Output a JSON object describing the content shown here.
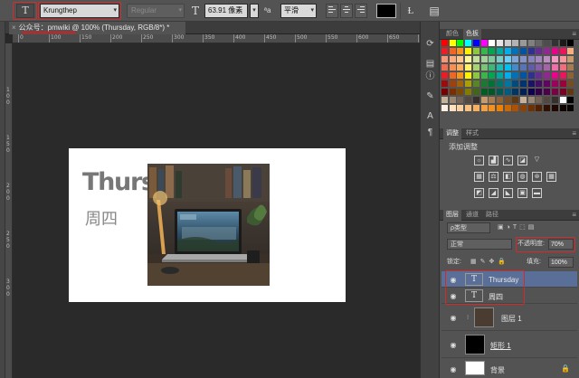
{
  "options_bar": {
    "tool_icon": "T",
    "font_family": "Krungthep",
    "font_style": "Regular",
    "font_size": "63.91 像素",
    "antialias_icon": "ªa",
    "antialias": "平滑",
    "text_color": "#000000"
  },
  "document": {
    "tab_title": "公众号：pmwiki @ 100% (Thursday, RGB/8*) *",
    "tab_close": "×",
    "ruler_h": [
      "0",
      "100",
      "150",
      "200",
      "250",
      "300",
      "350",
      "400",
      "450",
      "500",
      "550",
      "600",
      "650",
      "700"
    ],
    "ruler_v": [
      "1",
      "0",
      "0",
      "1",
      "5",
      "0",
      "2",
      "0",
      "0",
      "2",
      "5",
      "0",
      "3",
      "0",
      "0"
    ]
  },
  "canvas": {
    "heading": "Thursday",
    "subheading": "周四",
    "background": "#ffffff"
  },
  "panels": {
    "swatches_tabs": [
      "颜色",
      "色板"
    ],
    "adjust_tabs": [
      "调整",
      "样式"
    ],
    "adjust_title": "添加调整",
    "layers_tabs": [
      "图层",
      "通道",
      "路径"
    ],
    "filter_kind": "ρ类型",
    "blend_mode": "正常",
    "opacity_label": "不透明度:",
    "opacity_value": "70%",
    "lock_label": "锁定:",
    "fill_label": "填充:",
    "fill_value": "100%",
    "layers": [
      {
        "name": "Thursday",
        "type": "text",
        "selected": true
      },
      {
        "name": "周四",
        "type": "text"
      },
      {
        "name": "图层 1",
        "type": "image"
      },
      {
        "name": "矩形 1",
        "type": "shape"
      },
      {
        "name": "背景",
        "type": "background"
      }
    ]
  },
  "colors": {
    "highlight_red": "#d52a2a",
    "panel_bg": "#535353",
    "workspace_bg": "#2a2a2a",
    "selected_layer": "#5a6f98"
  },
  "icons": [
    "text-tool-icon",
    "font-size-icon",
    "antialias-icon",
    "align-left-icon",
    "align-center-icon",
    "align-right-icon",
    "warp-text-icon",
    "character-panel-icon",
    "eye-icon",
    "lock-icon",
    "link-icon",
    "fx-icon",
    "mask-icon",
    "new-layer-icon",
    "trash-icon"
  ]
}
